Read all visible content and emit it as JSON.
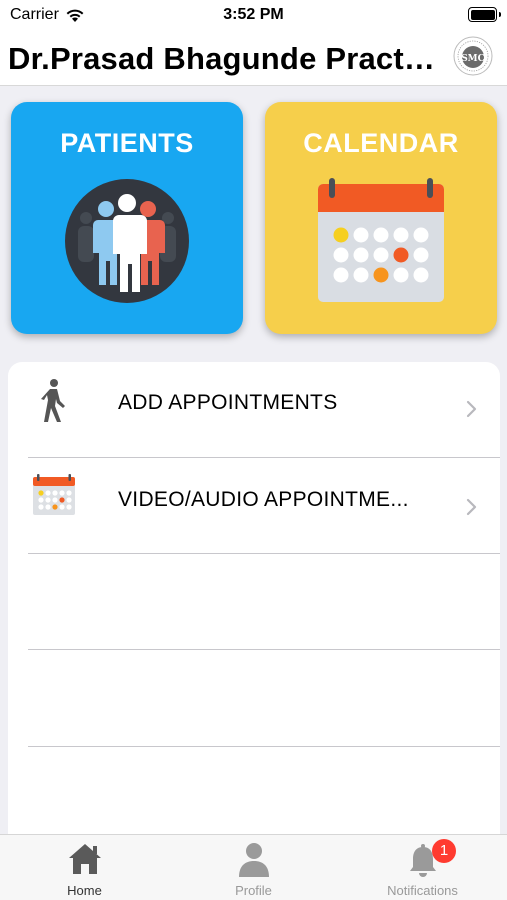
{
  "status_bar": {
    "carrier": "Carrier",
    "time": "3:52 PM"
  },
  "header": {
    "title": "Dr.Prasad Bhagunde Practice",
    "logo_text": "SMC"
  },
  "tiles": [
    {
      "label": "PATIENTS",
      "icon": "people-group-icon",
      "color": "#18a7f1"
    },
    {
      "label": "CALENDAR",
      "icon": "calendar-icon",
      "color": "#f6cf4b"
    }
  ],
  "list": {
    "items": [
      {
        "label": "ADD APPOINTMENTS",
        "icon": "walking-person-icon"
      },
      {
        "label": "VIDEO/AUDIO APPOINTME...",
        "icon": "calendar-icon"
      }
    ]
  },
  "tab_bar": {
    "tabs": [
      {
        "label": "Home",
        "icon": "home-icon",
        "active": true
      },
      {
        "label": "Profile",
        "icon": "person-icon",
        "active": false
      },
      {
        "label": "Notifications",
        "icon": "bell-icon",
        "active": false,
        "badge": "1"
      }
    ]
  },
  "colors": {
    "patients_tile": "#18a7f1",
    "calendar_tile": "#f6cf4b",
    "badge": "#ff3b30",
    "calendar_header": "#f15a24"
  }
}
